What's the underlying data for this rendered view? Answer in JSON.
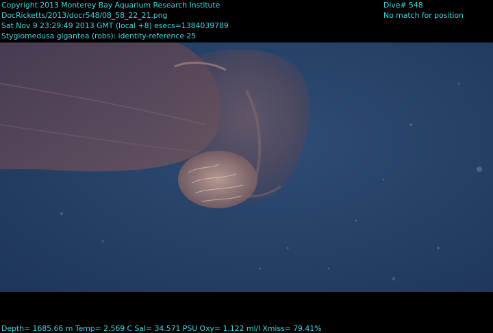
{
  "header": {
    "copyright": "Copyright 2013 Monterey Bay Aquarium Research Institute",
    "file_path": "DocRicketts/2013/docr548/08_58_22_21.png",
    "timestamp": "Sat Nov  9 23:29:49 2013 GMT (local +8)  esecs=1384039789",
    "annotation": "Stygiomedusa gigantea (robs): identity-reference 25",
    "dive": "Dive# 548",
    "position": "No match for position"
  },
  "footer": {
    "sensor_line": "Depth= 1685.66 m  Temp= 2.569 C  Sal= 34.571 PSU  Oxy= 1.122 ml/l  Xmiss= 79.41%"
  },
  "colors": {
    "overlay_text": "#3fd7e6",
    "water": "#264268",
    "background": "#000000"
  }
}
